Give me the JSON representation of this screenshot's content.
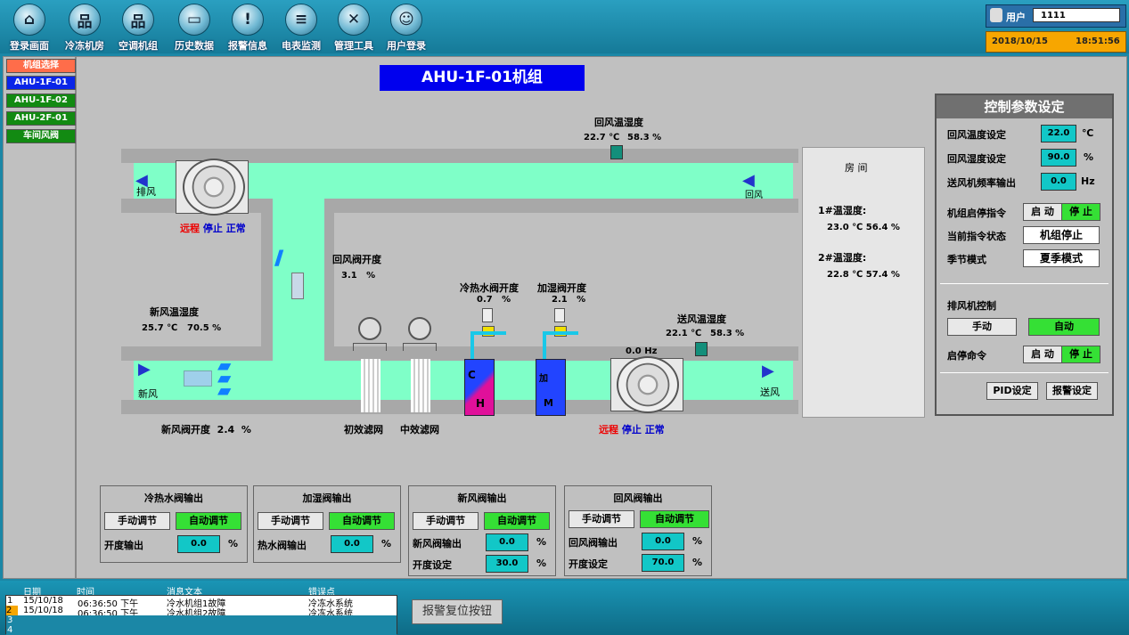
{
  "nav": [
    {
      "label": "登录画面",
      "icon": "home-icon",
      "glyph": "⌂"
    },
    {
      "label": "冷冻机房",
      "icon": "network-icon",
      "glyph": "品"
    },
    {
      "label": "空调机组",
      "icon": "hierarchy-icon",
      "glyph": "品"
    },
    {
      "label": "历史数据",
      "icon": "folder-icon",
      "glyph": "▭"
    },
    {
      "label": "报警信息",
      "icon": "warning-icon",
      "glyph": "!"
    },
    {
      "label": "电表监测",
      "icon": "document-icon",
      "glyph": "≡"
    },
    {
      "label": "管理工具",
      "icon": "tools-icon",
      "glyph": "✕"
    },
    {
      "label": "用户登录",
      "icon": "users-icon",
      "glyph": "☺"
    }
  ],
  "user": {
    "label": "用户",
    "value": "1111"
  },
  "datetime": {
    "date": "2018/10/15",
    "time": "18:51:56"
  },
  "left": {
    "title": "机组选择",
    "items": [
      "AHU-1F-01",
      "AHU-1F-02",
      "AHU-2F-01",
      "车间风阀"
    ]
  },
  "main": {
    "unit_title": "AHU-1F-01机组",
    "return_th": {
      "label": "回风温湿度",
      "temp": "22.7 ℃",
      "hum": "58.3 %"
    },
    "exhaust_label": "排风",
    "return_label": "回风",
    "exhaust_fan_status": {
      "remote": "远程",
      "stop": "停止",
      "normal": "正常"
    },
    "return_damper": {
      "label": "回风阀开度",
      "value": "3.1",
      "unit": "%"
    },
    "fresh_th": {
      "label": "新风温湿度",
      "temp": "25.7 ℃",
      "hum": "70.5 %"
    },
    "fresh_label": "新风",
    "fresh_damper": {
      "label": "新风阀开度",
      "value": "2.4",
      "unit": "%"
    },
    "chw_valve": {
      "label": "冷热水阀开度",
      "value": "0.7",
      "unit": "%"
    },
    "hum_valve": {
      "label": "加湿阀开度",
      "value": "2.1",
      "unit": "%"
    },
    "filter1": "初效滤网",
    "filter2": "中效滤网",
    "coil_c": "C",
    "coil_h": "H",
    "hum_top": "加",
    "hum_m": "M",
    "supply_freq": "0.0  Hz",
    "supply_th": {
      "label": "送风温湿度",
      "temp": "22.1 ℃",
      "hum": "58.3 %"
    },
    "supply_label": "送风",
    "supply_fan_status": {
      "remote": "远程",
      "stop": "停止",
      "normal": "正常"
    },
    "room": {
      "title": "房 间",
      "s1_label": "1#温湿度:",
      "s1_value": "23.0 ℃  56.4 %",
      "s2_label": "2#温湿度:",
      "s2_value": "22.8 ℃  57.4 %"
    }
  },
  "control": {
    "title": "控制参数设定",
    "return_temp": {
      "label": "回风温度设定",
      "value": "22.0",
      "unit": "℃"
    },
    "return_hum": {
      "label": "回风湿度设定",
      "value": "90.0",
      "unit": "%"
    },
    "fan_freq": {
      "label": "送风机频率输出",
      "value": "0.0",
      "unit": "Hz"
    },
    "start_cmd": {
      "label": "机组启停指令",
      "start": "启 动",
      "stop": "停 止"
    },
    "cur_state": {
      "label": "当前指令状态",
      "value": "机组停止"
    },
    "season": {
      "label": "季节模式",
      "value": "夏季模式"
    },
    "exhaust_ctrl": "排风机控制",
    "manual": "手动",
    "auto": "自动",
    "start_stop": {
      "label": "启停命令",
      "start": "启 动",
      "stop": "停 止"
    },
    "pid": "PID设定",
    "alarm_set": "报警设定"
  },
  "groups": [
    {
      "title": "冷热水阀输出",
      "manual": "手动调节",
      "auto": "自动调节",
      "rows": [
        {
          "label": "开度输出",
          "value": "0.0",
          "unit": "%"
        }
      ]
    },
    {
      "title": "加湿阀输出",
      "manual": "手动调节",
      "auto": "自动调节",
      "rows": [
        {
          "label": "热水阀输出",
          "value": "0.0",
          "unit": "%"
        }
      ]
    },
    {
      "title": "新风阀输出",
      "manual": "手动调节",
      "auto": "自动调节",
      "rows": [
        {
          "label": "新风阀输出",
          "value": "0.0",
          "unit": "%"
        },
        {
          "label": "开度设定",
          "value": "30.0",
          "unit": "%"
        }
      ]
    },
    {
      "title": "回风阀输出",
      "manual": "手动调节",
      "auto": "自动调节",
      "rows": [
        {
          "label": "回风阀输出",
          "value": "0.0",
          "unit": "%"
        },
        {
          "label": "开度设定",
          "value": "70.0",
          "unit": "%"
        }
      ]
    }
  ],
  "alarm": {
    "headers": [
      "日期",
      "时间",
      "消息文本",
      "错误点"
    ],
    "rows": [
      {
        "n": "1",
        "date": "15/10/18",
        "time": "06:36:50 下午",
        "msg": "冷水机组1故障",
        "point": "冷冻水系统"
      },
      {
        "n": "2",
        "date": "15/10/18",
        "time": "06:36:50 下午",
        "msg": "冷水机组2故障",
        "point": "冷冻水系统"
      },
      {
        "n": "3",
        "date": "",
        "time": "",
        "msg": "",
        "point": ""
      },
      {
        "n": "4",
        "date": "",
        "time": "",
        "msg": "",
        "point": ""
      }
    ],
    "reset_button": "报警复位按钮"
  },
  "colors": {
    "accent_green": "#35e035",
    "value_cyan": "#12c7c7",
    "duct_green": "#7fffc8",
    "title_blue": "#0000ee"
  }
}
